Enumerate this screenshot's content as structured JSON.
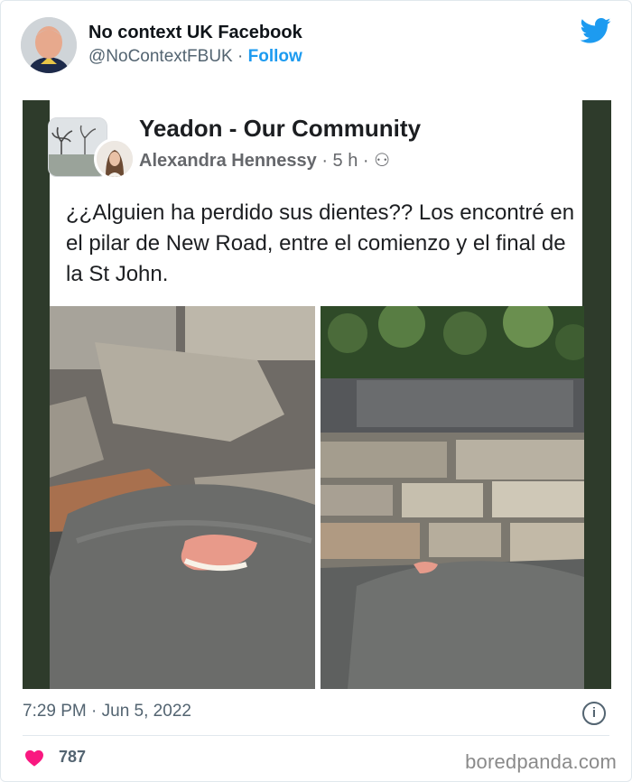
{
  "tweet": {
    "display_name": "No context UK Facebook",
    "handle": "@NoContextFBUK",
    "separator": " · ",
    "follow_label": "Follow",
    "timestamp": "7:29 PM · Jun 5, 2022",
    "likes": "787",
    "info_glyph": "i"
  },
  "fb_post": {
    "group_name": "Yeadon - Our Community",
    "author": "Alexandra Hennessy",
    "age": " · 5 h · ",
    "text": "¿¿Alguien ha perdido sus dientes?? Los encontré en el pilar de New Road, entre el comienzo y el final de la St John."
  },
  "watermark": "boredpanda.com",
  "colors": {
    "accent": "#1d9bf0",
    "heart": "#f91880",
    "frame": "#2e3b2b"
  }
}
